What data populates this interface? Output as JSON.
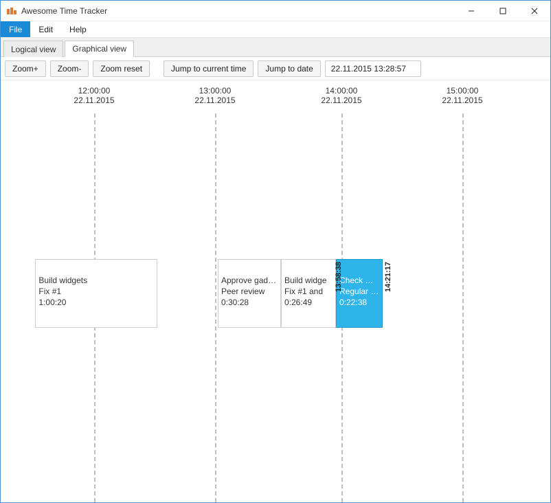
{
  "window": {
    "title": "Awesome Time Tracker"
  },
  "menu": {
    "items": [
      {
        "label": "File",
        "active": true
      },
      {
        "label": "Edit",
        "active": false
      },
      {
        "label": "Help",
        "active": false
      }
    ]
  },
  "tabs": {
    "items": [
      {
        "label": "Logical view",
        "active": false
      },
      {
        "label": "Graphical view",
        "active": true
      }
    ]
  },
  "toolbar": {
    "zoom_in": "Zoom+",
    "zoom_out": "Zoom-",
    "zoom_reset": "Zoom reset",
    "jump_current": "Jump to current time",
    "jump_date": "Jump to date",
    "date_value": "22.11.2015 13:28:57"
  },
  "timeline": {
    "ticks": [
      {
        "time": "12:00:00",
        "date": "22.11.2015",
        "x_pct": 17
      },
      {
        "time": "13:00:00",
        "date": "22.11.2015",
        "x_pct": 39
      },
      {
        "time": "14:00:00",
        "date": "22.11.2015",
        "x_pct": 62
      },
      {
        "time": "15:00:00",
        "date": "22.11.2015",
        "x_pct": 84
      }
    ],
    "events": [
      {
        "title": "Build widgets",
        "subtitle": "Fix #1",
        "duration": "1:00:20",
        "left_pct": 6.3,
        "width_pct": 22.2,
        "highlight": false
      },
      {
        "title": "Approve gadgets",
        "subtitle": "Peer review",
        "duration": "0:30:28",
        "left_pct": 39.5,
        "width_pct": 11.5,
        "highlight": false
      },
      {
        "title": "Build widge",
        "subtitle": "Fix #1 and ",
        "duration": "0:26:49",
        "left_pct": 51,
        "width_pct": 10,
        "highlight": false
      },
      {
        "title": "Check wid...",
        "subtitle": "Regular ch...",
        "duration": "0:22:38",
        "left_pct": 61,
        "width_pct": 8.5,
        "highlight": true
      }
    ],
    "markers": [
      {
        "label": "13:58:38",
        "x_pct": 61.5
      },
      {
        "label": "14:21:17",
        "x_pct": 70.5
      }
    ]
  }
}
